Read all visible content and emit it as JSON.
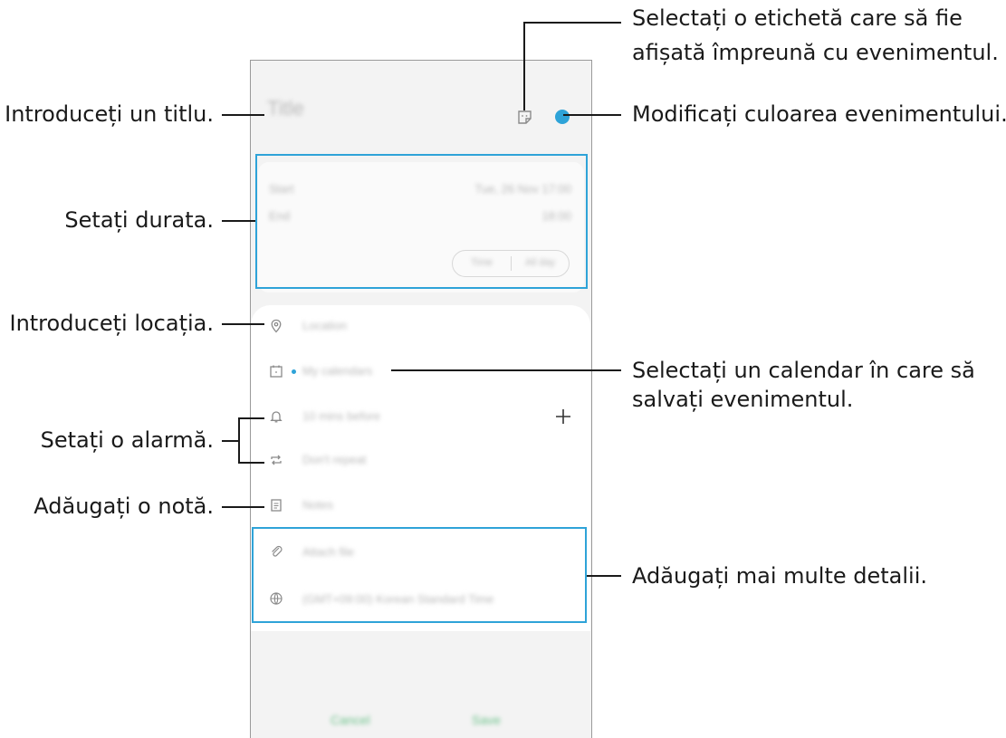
{
  "callouts": {
    "title": "Introduceți un titlu.",
    "duration": "Setați durata.",
    "location": "Introduceți locația.",
    "alarm": "Setați o alarmă.",
    "note": "Adăugați o notă.",
    "sticker_line1": "Selectați o etichetă care să fie",
    "sticker_line2": "afișată împreună cu evenimentul.",
    "color": "Modificați culoarea evenimentului.",
    "calendar_line1": "Selectați un calendar în care să",
    "calendar_line2": "salvați evenimentul.",
    "details": "Adăugați mai multe detalii."
  },
  "event": {
    "title_placeholder": "Title",
    "start_label": "Start",
    "start_value": "Tue, 26 Nov  17:00",
    "end_label": "End",
    "end_value": "18:00",
    "timezone_options": [
      "Time",
      "All day"
    ],
    "location_placeholder": "Location",
    "calendar": "My calendars",
    "reminder": "10 mins before",
    "repeat": "Don't repeat",
    "notes": "Notes",
    "attach": "Attach file",
    "timezone": "(GMT+09:00) Korean Standard Time"
  },
  "actions": {
    "cancel": "Cancel",
    "save": "Save"
  },
  "colors": {
    "accent": "#2ea3d8",
    "action_text": "#6cc28a"
  },
  "icons": [
    "sticker-icon",
    "location-pin-icon",
    "calendar-icon",
    "bell-icon",
    "repeat-icon",
    "notes-icon",
    "paperclip-icon",
    "globe-icon",
    "plus-icon"
  ]
}
